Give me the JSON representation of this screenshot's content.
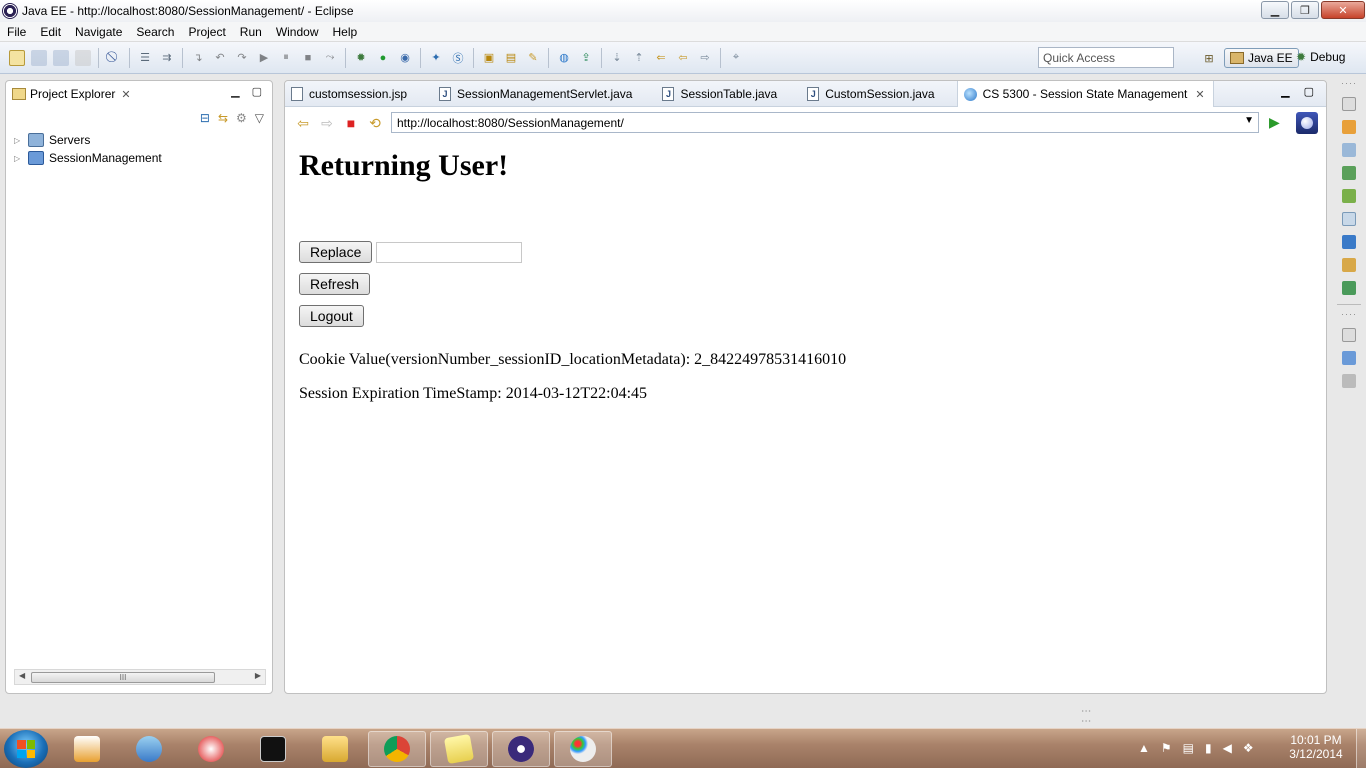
{
  "window": {
    "title": "Java EE - http://localhost:8080/SessionManagement/ - Eclipse"
  },
  "menu": [
    "File",
    "Edit",
    "Navigate",
    "Search",
    "Project",
    "Run",
    "Window",
    "Help"
  ],
  "toolbar": {
    "quick_access_placeholder": "Quick Access",
    "perspective_active": "Java EE",
    "perspective_debug": "Debug"
  },
  "project_explorer": {
    "title": "Project Explorer",
    "tree": [
      "Servers",
      "SessionManagement"
    ],
    "scroll_grip": "III"
  },
  "editor": {
    "tabs": [
      "customsession.jsp",
      "SessionManagementServlet.java",
      "SessionTable.java",
      "CustomSession.java",
      "CS 5300 - Session State Management"
    ],
    "active_tab": "CS 5300 - Session State Management",
    "url": "http://localhost:8080/SessionManagement/"
  },
  "page": {
    "heading": "Returning User!",
    "replace_label": "Replace",
    "replace_value": "",
    "refresh_label": "Refresh",
    "logout_label": "Logout",
    "cookie_line": "Cookie Value(versionNumber_sessionID_locationMetadata): 2_84224978531416010",
    "expiry_line": "Session Expiration TimeStamp: 2014-03-12T22:04:45"
  },
  "taskbar": {
    "time": "10:01 PM",
    "date": "3/12/2014"
  },
  "colors": {
    "accent": "#2c78c9",
    "eclipse": "#2c2255",
    "taskbar": "#a9826a"
  }
}
